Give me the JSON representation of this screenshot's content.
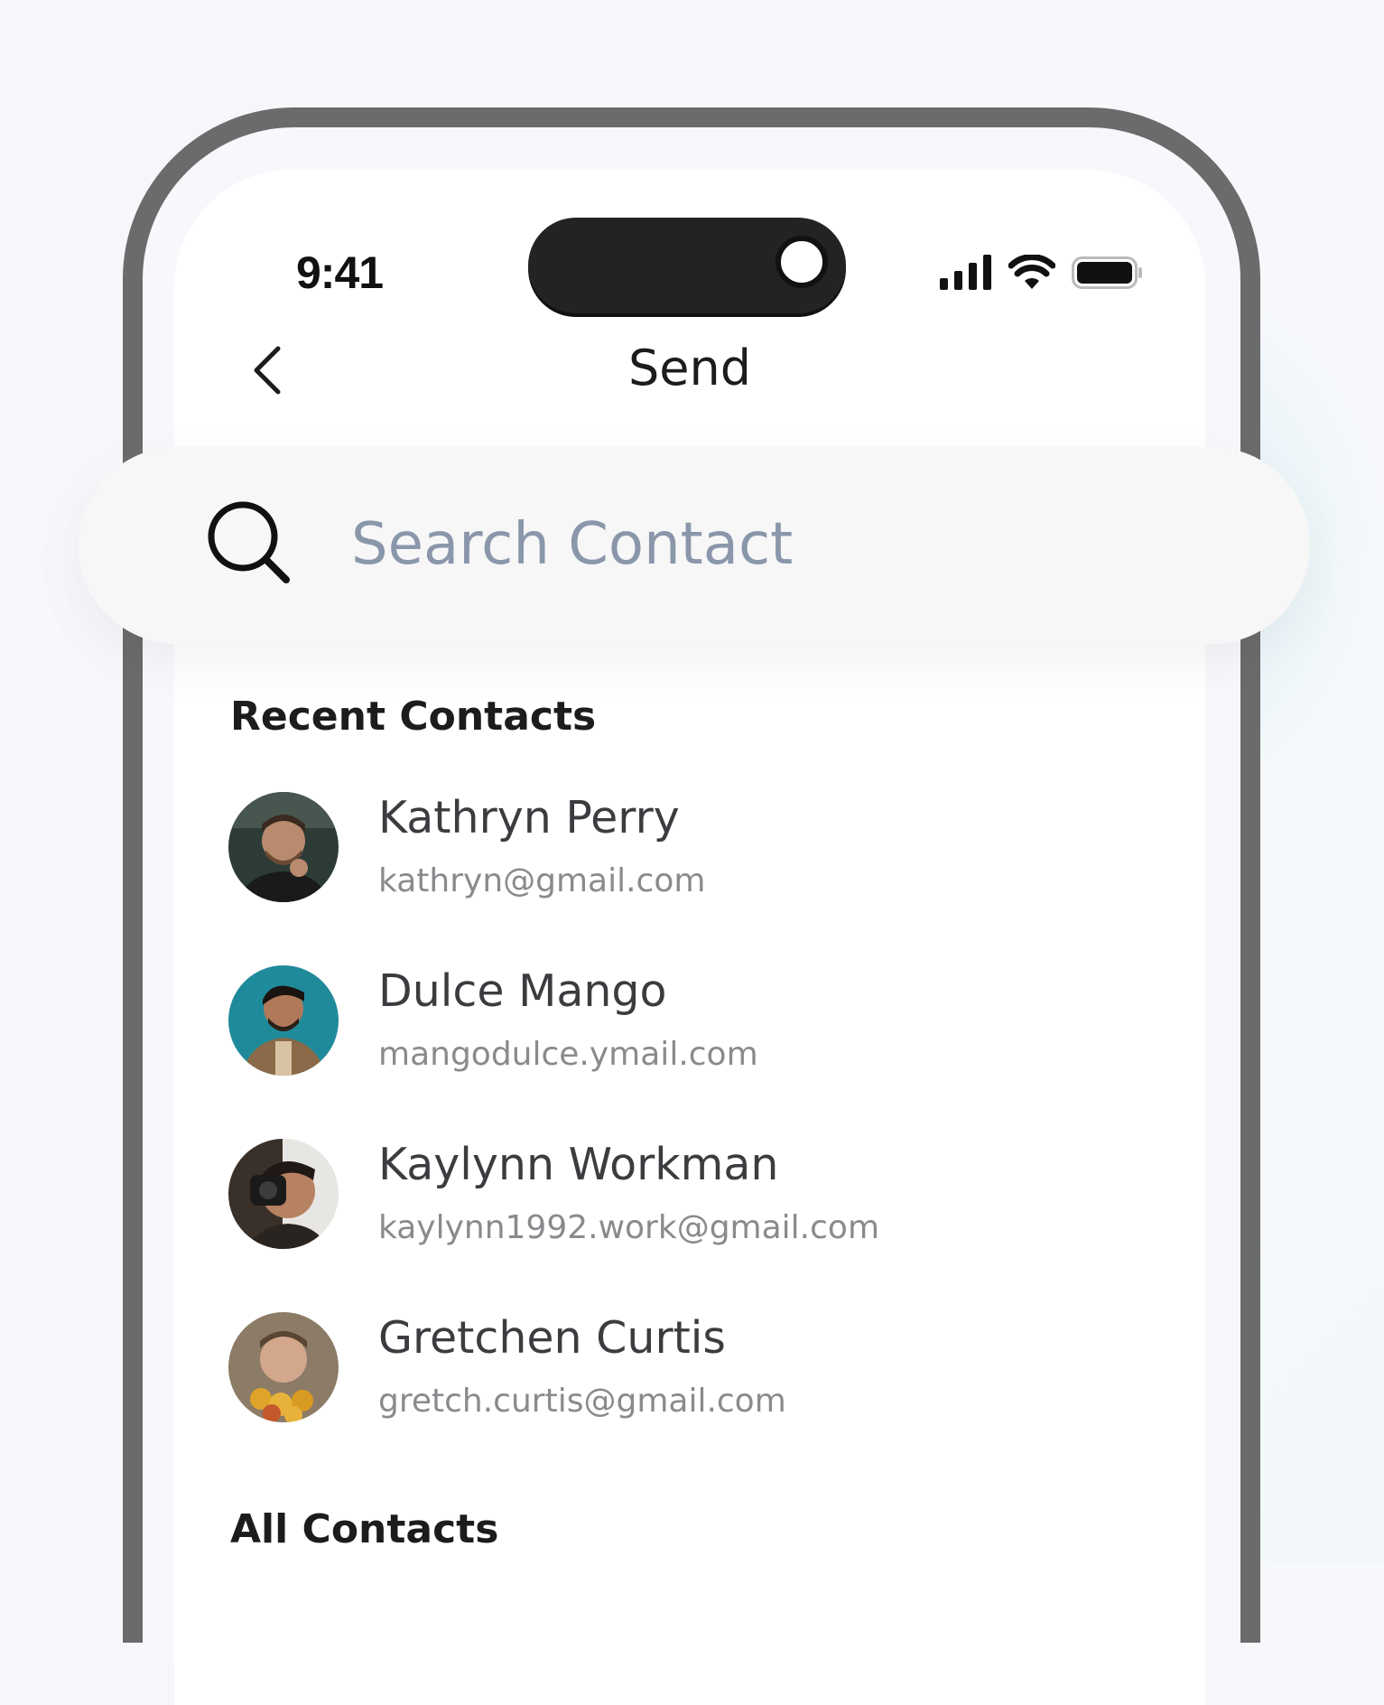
{
  "status_bar": {
    "time": "9:41",
    "icons": [
      "cellular-signal-icon",
      "wifi-icon",
      "battery-icon"
    ]
  },
  "header": {
    "title": "Send",
    "back_icon": "chevron-left-icon"
  },
  "search": {
    "placeholder": "Search Contact",
    "value": "",
    "icon": "search-icon"
  },
  "sections": {
    "recent_title": "Recent Contacts",
    "all_title": "All Contacts"
  },
  "recent_contacts": [
    {
      "name": "Kathryn Perry",
      "email": "kathryn@gmail.com"
    },
    {
      "name": "Dulce Mango",
      "email": "mangodulce.ymail.com"
    },
    {
      "name": "Kaylynn Workman",
      "email": "kaylynn1992.work@gmail.com"
    },
    {
      "name": "Gretchen Curtis",
      "email": "gretch.curtis@gmail.com"
    }
  ],
  "colors": {
    "frame": "#6b6b6b",
    "placeholder": "#8a97ab",
    "title_text": "#1c1c1e",
    "email_text": "#8a8a8e"
  }
}
